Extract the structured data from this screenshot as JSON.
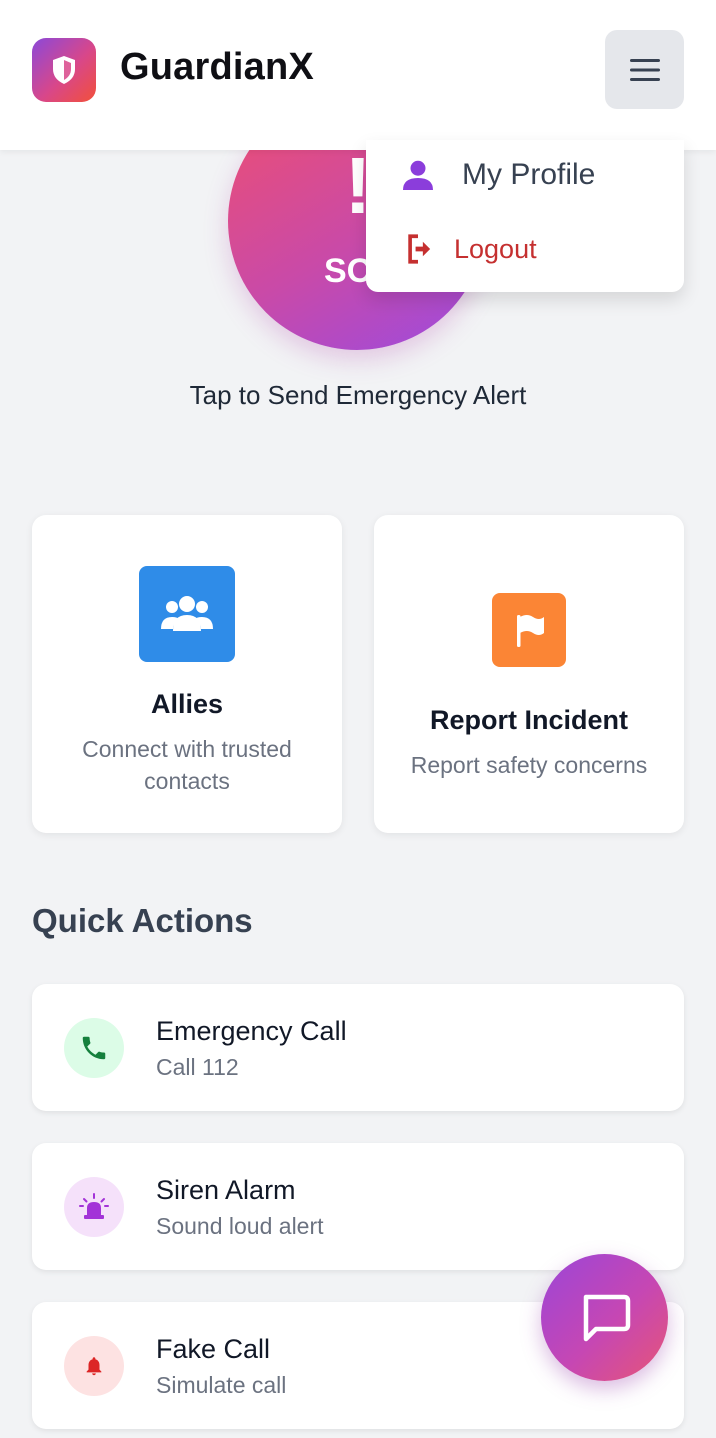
{
  "header": {
    "app_title": "GuardianX",
    "logo_icon": "shield-icon",
    "menu_icon": "hamburger-menu-icon"
  },
  "sos": {
    "exclaim": "!",
    "label": "SOS",
    "caption": "Tap to Send Emergency Alert"
  },
  "dropdown": {
    "items": [
      {
        "label": "My Profile",
        "icon": "user-icon",
        "color": "#8b3ddb"
      },
      {
        "label": "Logout",
        "icon": "logout-icon",
        "color": "#c53030"
      }
    ]
  },
  "cards": [
    {
      "title": "Allies",
      "subtitle": "Connect with trusted contacts",
      "icon": "users-group-icon",
      "color": "#2f8ce8"
    },
    {
      "title": "Report Incident",
      "subtitle": "Report safety concerns",
      "icon": "flag-icon",
      "color": "#fb8535"
    }
  ],
  "quick_actions": {
    "heading": "Quick Actions",
    "items": [
      {
        "title": "Emergency Call",
        "subtitle": "Call 112",
        "icon": "phone-icon",
        "color": "#15803d",
        "bg": "#dcfce7"
      },
      {
        "title": "Siren Alarm",
        "subtitle": "Sound loud alert",
        "icon": "siren-icon",
        "color": "#a333d8",
        "bg": "#f5e1fa"
      },
      {
        "title": "Fake Call",
        "subtitle": "Simulate call",
        "icon": "bell-icon",
        "color": "#dc2626",
        "bg": "#fde2e2"
      }
    ]
  },
  "fab": {
    "icon": "chat-bubble-icon"
  }
}
